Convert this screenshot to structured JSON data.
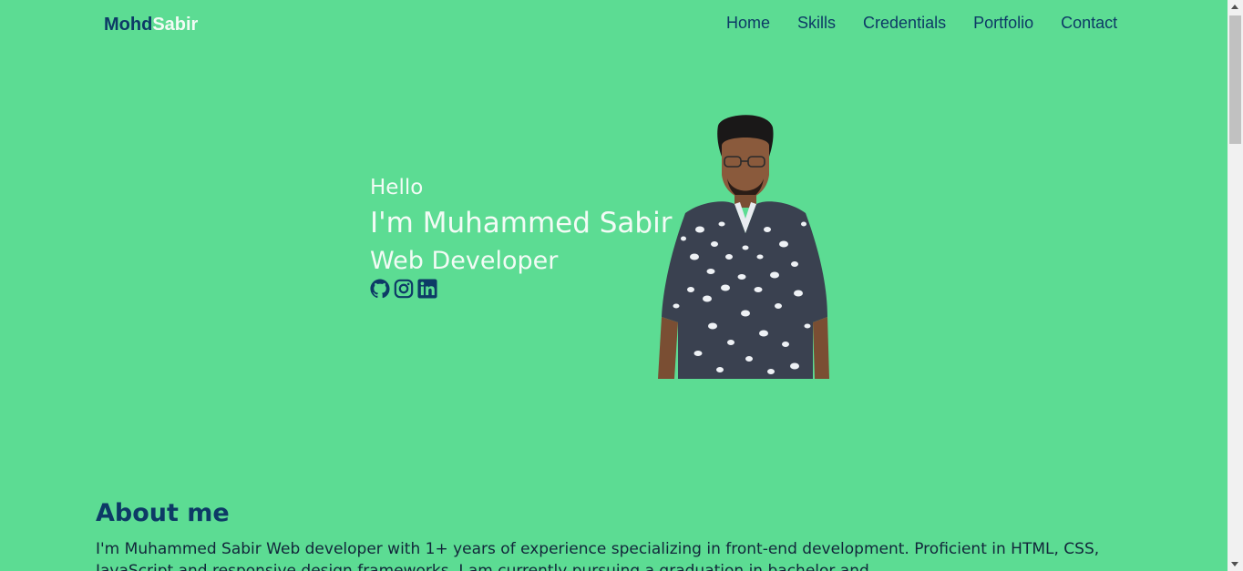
{
  "logo": {
    "part1": "Mohd",
    "part2": "Sabir"
  },
  "nav": {
    "items": [
      "Home",
      "Skills",
      "Credentials",
      "Portfolio",
      "Contact"
    ]
  },
  "hero": {
    "greeting": "Hello",
    "name": "I'm Muhammed Sabir",
    "role": "Web Developer",
    "socials": [
      "github-icon",
      "instagram-icon",
      "linkedin-icon"
    ]
  },
  "about": {
    "title": "About me",
    "text": "I'm Muhammed Sabir Web developer with 1+ years of experience specializing in front-end development. Proficient in HTML, CSS, JavaScript and responsive design frameworks. I am currently pursuing a graduation in bachelor and ..."
  },
  "colors": {
    "background": "#5cdc93",
    "accent": "#0d3a66",
    "light_text": "#f2fbf5"
  }
}
